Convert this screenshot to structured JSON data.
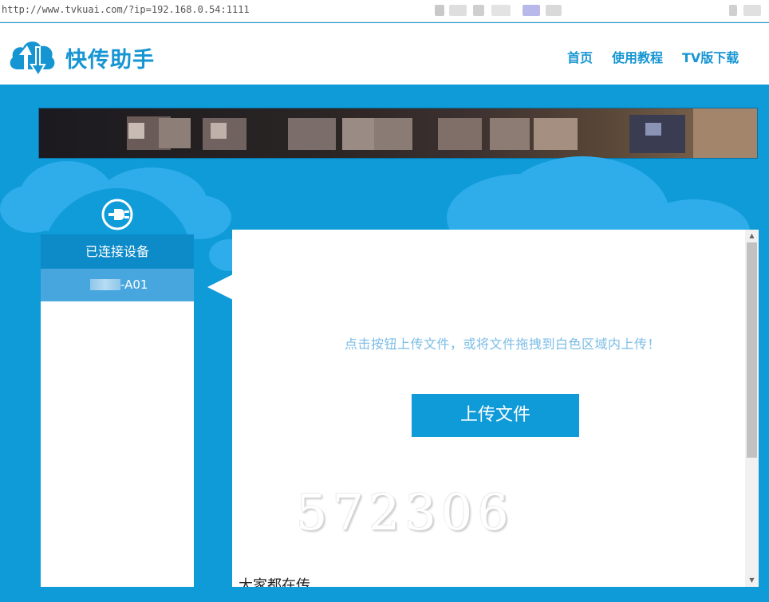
{
  "browser": {
    "url": "http://www.tvkuai.com/?ip=192.168.0.54:1111"
  },
  "header": {
    "brand": "快传助手",
    "logo_icon": "cloud-transfer-icon",
    "nav": [
      {
        "label": "首页"
      },
      {
        "label": "使用教程"
      },
      {
        "label": "TV版下载"
      }
    ]
  },
  "sidebar": {
    "icon": "plug-icon",
    "title": "已连接设备",
    "devices": [
      {
        "label": "-A01"
      }
    ]
  },
  "main": {
    "hint": "点击按钮上传文件，或将文件拖拽到白色区域内上传！",
    "upload_label": "上传文件",
    "watermark": "572306",
    "section_title": "大家都在传"
  },
  "colors": {
    "primary": "#0f9ad8",
    "dark_blue": "#0d8bc9",
    "selected": "#48a6df",
    "hint_text": "#7bbde6"
  }
}
